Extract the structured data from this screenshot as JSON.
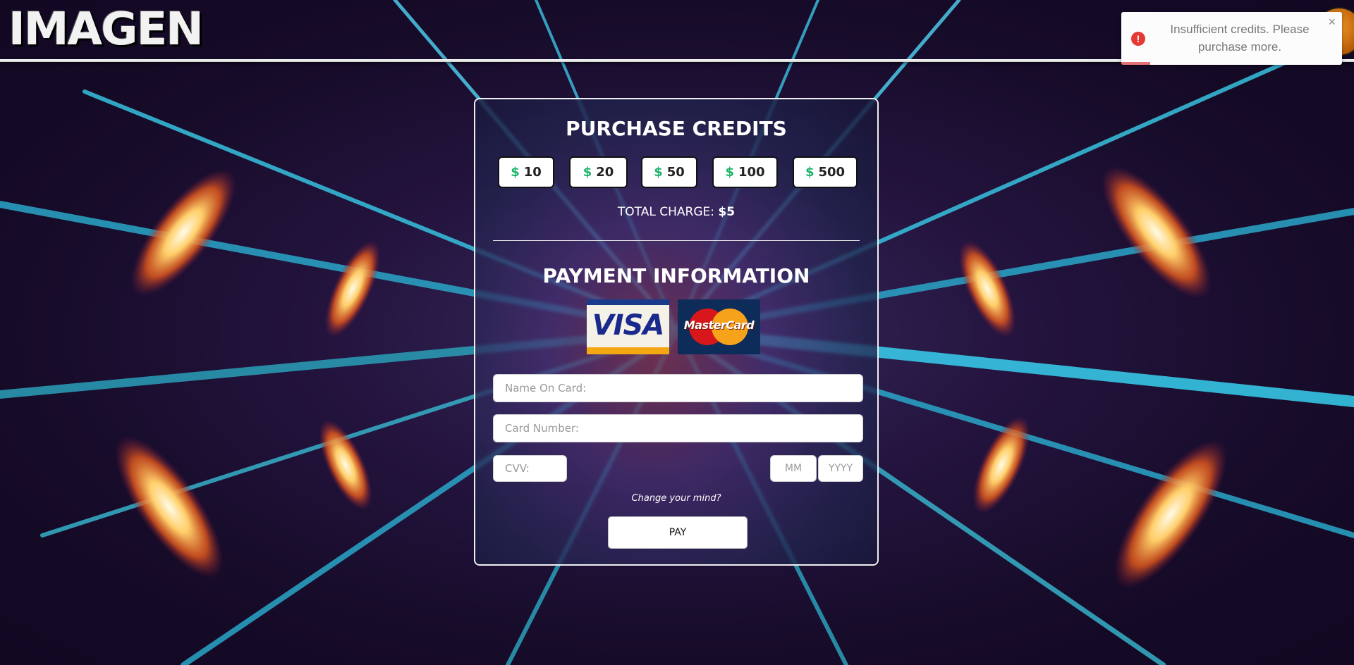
{
  "header": {
    "logo": "IMAGEN"
  },
  "toast": {
    "message": "Insufficient credits. Please purchase more.",
    "close": "×",
    "icon": "!"
  },
  "purchase": {
    "title": "PURCHASE CREDITS",
    "amounts": [
      {
        "symbol": "$",
        "value": "10"
      },
      {
        "symbol": "$",
        "value": "20"
      },
      {
        "symbol": "$",
        "value": "50"
      },
      {
        "symbol": "$",
        "value": "100"
      },
      {
        "symbol": "$",
        "value": "500"
      }
    ],
    "total_label": "TOTAL CHARGE:",
    "total_value": "$5"
  },
  "payment": {
    "title": "PAYMENT INFORMATION",
    "visa_label": "VISA",
    "mastercard_label": "MasterCard",
    "name_placeholder": "Name On Card:",
    "number_placeholder": "Card Number:",
    "cvv_placeholder": "CVV:",
    "mm_placeholder": "MM",
    "yyyy_placeholder": "YYYY",
    "change_text": "Change your mind?",
    "pay_label": "PAY"
  },
  "colors": {
    "accent_dollar": "#1fb36b",
    "toast_error": "#e53935",
    "card_border": "#f0f0f0"
  }
}
